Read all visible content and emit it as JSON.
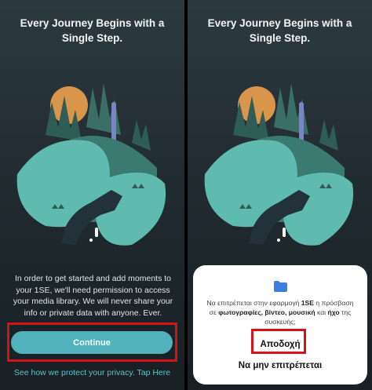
{
  "onboarding": {
    "title": "Every Journey Begins with a Single Step.",
    "description": "In order to get started and add moments to your 1SE, we'll need permission to access your media library. We will never share your info or private data with anyone. Ever.",
    "continue_label": "Continue",
    "privacy_link": "See how we protect your privacy. Tap Here"
  },
  "dialog": {
    "text_intro": "Να επιτρέπεται στην εφαρμογή ",
    "app_name": "1SE",
    "text_mid": " η πρόσβαση σε ",
    "media_types": "φωτογραφίες, βίντεο, μουσική",
    "and_word": " και ",
    "media_audio": "ήχο",
    "text_end": " της συσκευής;",
    "allow_label": "Αποδοχή",
    "deny_label": "Να μην επιτρέπεται"
  },
  "colors": {
    "accent": "#52b2bb",
    "highlight": "#d3121a",
    "sun": "#d9954a",
    "waterfall": "#7a86c4"
  },
  "icons": [
    "folder-icon"
  ]
}
